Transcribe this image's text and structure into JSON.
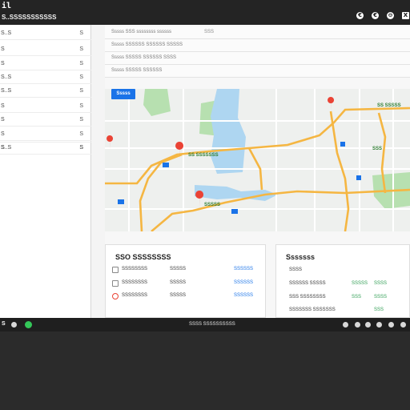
{
  "window": {
    "app_logo": "il",
    "title": "S..SSSSSSSSSSS",
    "controls": [
      "€",
      "€",
      "⊖",
      "X"
    ]
  },
  "sidebar": {
    "items": [
      {
        "label": "S..S",
        "count": "S"
      },
      {
        "label": "S",
        "count": "S"
      },
      {
        "label": "S",
        "count": "S"
      },
      {
        "label": "S..S",
        "count": "S"
      },
      {
        "label": "S..S",
        "count": "S"
      },
      {
        "label": "S",
        "count": "S"
      },
      {
        "label": "S",
        "count": "S"
      },
      {
        "label": "S",
        "count": "S"
      },
      {
        "label": "S",
        "count": "S"
      },
      {
        "label": "S..S",
        "count": "S"
      }
    ]
  },
  "search_fields": [
    {
      "text": "Sssss SSS ssssssss ssssss",
      "extra": "SSS"
    },
    {
      "text": "Sssss SSSSSS SSSSSS SSSSS",
      "extra": ""
    },
    {
      "text": "Sssss SSSSS SSSSSS SSSS",
      "extra": ""
    },
    {
      "text": "Sssss SSSSS SSSSSS",
      "extra": ""
    }
  ],
  "search_button": "Sssss",
  "map": {
    "water_color": "#aed6f1",
    "park_color": "#b7e0b0",
    "road_color": "#f5b642",
    "pin_color": "#ea4335",
    "labels": [
      "SS SSSSSSS",
      "SSSSS",
      "SS SSSSS",
      "SSS"
    ]
  },
  "trips_card": {
    "title": "SSO SSSSSSSS",
    "rows": [
      {
        "icon": "train-icon",
        "name": "SSSSSSSS",
        "time": "SSSSS",
        "link": "SSSSSS"
      },
      {
        "icon": "bus-icon",
        "name": "SSSSSSSS",
        "time": "SSSSS",
        "link": "SSSSSS"
      },
      {
        "icon": "car-icon",
        "name": "SSSSSSSS",
        "time": "SSSSS",
        "link": "SSSSSS"
      }
    ]
  },
  "schedule_card": {
    "title": "Sssssss",
    "rows": [
      {
        "name": "SSSS",
        "a": "",
        "b": ""
      },
      {
        "name": "SSSSSS SSSSS",
        "a": "SSSSS",
        "b": "SSSS"
      },
      {
        "name": "SSS SSSSSSSS",
        "a": "SSS",
        "b": "SSSS"
      },
      {
        "name": "SSSSSSS SSSSSSS",
        "a": "",
        "b": "SSS"
      }
    ]
  },
  "taskbar": {
    "left_label": "S",
    "center_text": "SSSS SSSSSSSSSS"
  }
}
